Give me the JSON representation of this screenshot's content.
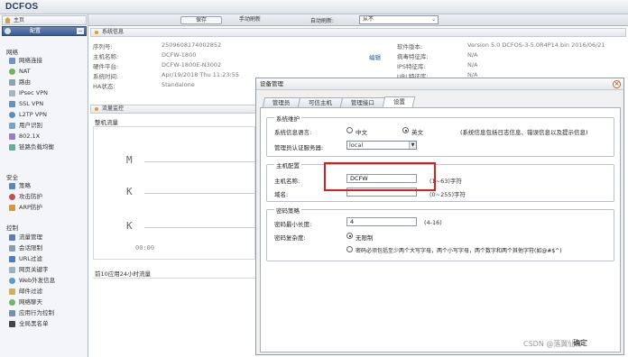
{
  "app": {
    "title": "DCFOS"
  },
  "toolbar": {
    "save_label": "保存",
    "refresh_label": "手动刷新",
    "auto_refresh_label": "自动刷新:",
    "auto_refresh_value": "从不"
  },
  "sidebar": {
    "home_label": "主页",
    "config_label": "配置",
    "collapse_label": "−",
    "sections": [
      {
        "title": "网络",
        "items": [
          "网络连接",
          "NAT",
          "路由",
          "IPsec VPN",
          "SSL VPN",
          "L2TP VPN",
          "用户识别",
          "802.1X",
          "链路负载均衡"
        ]
      },
      {
        "title": "安全",
        "items": [
          "策略",
          "攻击防护",
          "ARP防护"
        ]
      },
      {
        "title": "控制",
        "items": [
          "流量管理",
          "会话限制",
          "URL过滤",
          "网页关键字",
          "Web外发信息",
          "邮件过滤",
          "网络聊天",
          "应用行为控制",
          "全局黑名单"
        ]
      }
    ]
  },
  "system_info": {
    "header": "系统信息",
    "rows": [
      {
        "label": "序列号:",
        "value": "2509608174002852"
      },
      {
        "label": "主机名称:",
        "value": "DCFW-1800"
      },
      {
        "label": "硬件平台:",
        "value": "DCFW-1800E-N3002"
      },
      {
        "label": "系统时间:",
        "value": "Apr/19/2018  Thu  11:23:55"
      },
      {
        "label": "HA状态:",
        "value": "Standalone"
      }
    ],
    "edit_label": "编辑",
    "right_rows": [
      {
        "label": "软件版本:",
        "value": "Version 5.0 DCFOS-3-5.0R4P14.bin 2016/06/21"
      },
      {
        "label": "病毒特征库:",
        "value": "N/A"
      },
      {
        "label": "IPS特征库:",
        "value": "N/A"
      },
      {
        "label": "URL特征库:",
        "value": "N/A"
      }
    ]
  },
  "traffic": {
    "header": "流量监控",
    "sub_label": "整机流量",
    "y_marks": [
      "M",
      "K",
      "K"
    ],
    "x_tick": "00:00",
    "top10_label": "前10应用24小时流量"
  },
  "dialog": {
    "title": "设备管理",
    "close_icon": "close-icon",
    "tabs": [
      {
        "label": "管理员"
      },
      {
        "label": "可信主机"
      },
      {
        "label": "管理接口"
      },
      {
        "label": "设置",
        "active": true
      }
    ],
    "sys_maint": {
      "legend": "系统维护",
      "lang_label": "系统信息语言:",
      "lang_zh": "中文",
      "lang_en": "英文",
      "lang_selected": "英文",
      "lang_note": "(系统信息包括日志信息、错误信息以及提示信息)",
      "auth_label": "管理员认证服务器:",
      "auth_value": "local"
    },
    "host_cfg": {
      "legend": "主机配置",
      "hostname_label": "主机名称:",
      "hostname_value": "DCFW",
      "hostname_hint": "(1~63)字符",
      "domain_label": "域名:",
      "domain_value": "",
      "domain_hint": "(0~255)字符"
    },
    "pwd_policy": {
      "legend": "密码策略",
      "min_len_label": "密码最小长度:",
      "min_len_value": "4",
      "min_len_hint": "(4-16)",
      "complex_label": "密码复杂度:",
      "opt_none": "无限制",
      "opt_complex": "密码必须包括至少两个大写字母，两个小写字母，两个数字和两个其他字符(如@#$^)",
      "selected": "无限制"
    }
  },
  "footer": {
    "watermark": "CSDN @落翼仙神",
    "ok_label": "确定"
  },
  "colors": {
    "accent_nav": "#3b5a8e",
    "highlight_box": "#d71f1f",
    "header_bullet": "#e79b26"
  }
}
